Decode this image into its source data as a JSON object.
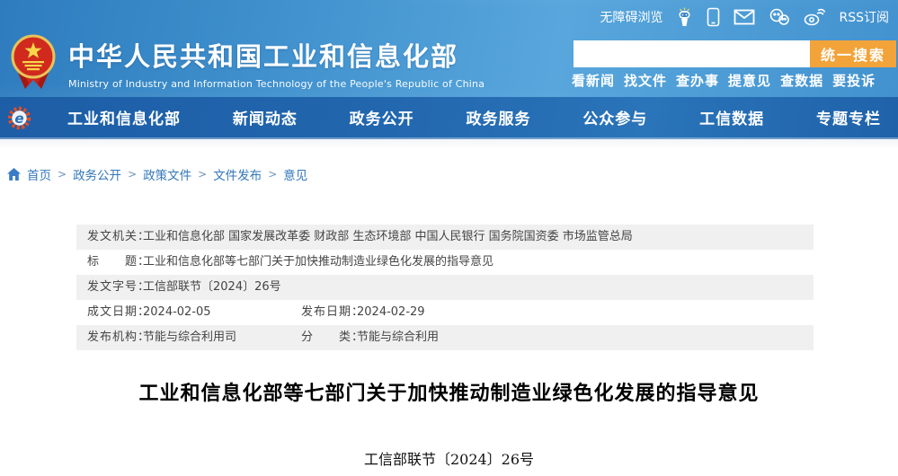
{
  "site": {
    "name_cn": "中华人民共和国工业和信息化部",
    "name_en": "Ministry of Industry and Information Technology of the People's Republic of China"
  },
  "topbar": {
    "accessibility_label": "无障碍浏览",
    "rss_label": "RSS订阅"
  },
  "search": {
    "placeholder": "",
    "value": "",
    "button_label": "统一搜索",
    "quick_links": [
      "看新闻",
      "找文件",
      "查办事",
      "提意见",
      "查数据",
      "要投诉"
    ]
  },
  "nav": {
    "items": [
      "工业和信息化部",
      "新闻动态",
      "政务公开",
      "政务服务",
      "公众参与",
      "工信数据",
      "专题专栏"
    ]
  },
  "breadcrumb": {
    "home": "首页",
    "separator": ">",
    "items": [
      "政务公开",
      "政策文件",
      "文件发布",
      "意见"
    ]
  },
  "doc_table": {
    "rows": [
      {
        "cells": [
          {
            "label": "发文机关：",
            "value": "工业和信息化部 国家发展改革委 财政部 生态环境部 中国人民银行 国务院国资委 市场监管总局"
          }
        ]
      },
      {
        "cells": [
          {
            "label": "标　　题：",
            "value": "工业和信息化部等七部门关于加快推动制造业绿色化发展的指导意见"
          }
        ]
      },
      {
        "cells": [
          {
            "label": "发文字号：",
            "value": "工信部联节〔2024〕26号"
          }
        ]
      },
      {
        "cells": [
          {
            "label": "成文日期：",
            "value": "2024-02-05"
          },
          {
            "label": "发布日期：",
            "value": "2024-02-29"
          }
        ]
      },
      {
        "cells": [
          {
            "label": "发布机构：",
            "value": "节能与综合利用司"
          },
          {
            "label": "分　　类：",
            "value": "节能与综合利用"
          }
        ]
      }
    ]
  },
  "article": {
    "title": "工业和信息化部等七部门关于加快推动制造业绿色化发展的指导意见",
    "doc_number_line": "工信部联节〔2024〕26号"
  },
  "colors": {
    "header_blue": "#3f90cd",
    "nav_blue": "#2165ad",
    "accent_orange": "#f2a33a",
    "link_blue": "#3377b9",
    "row_gray": "#f0f0f0"
  }
}
